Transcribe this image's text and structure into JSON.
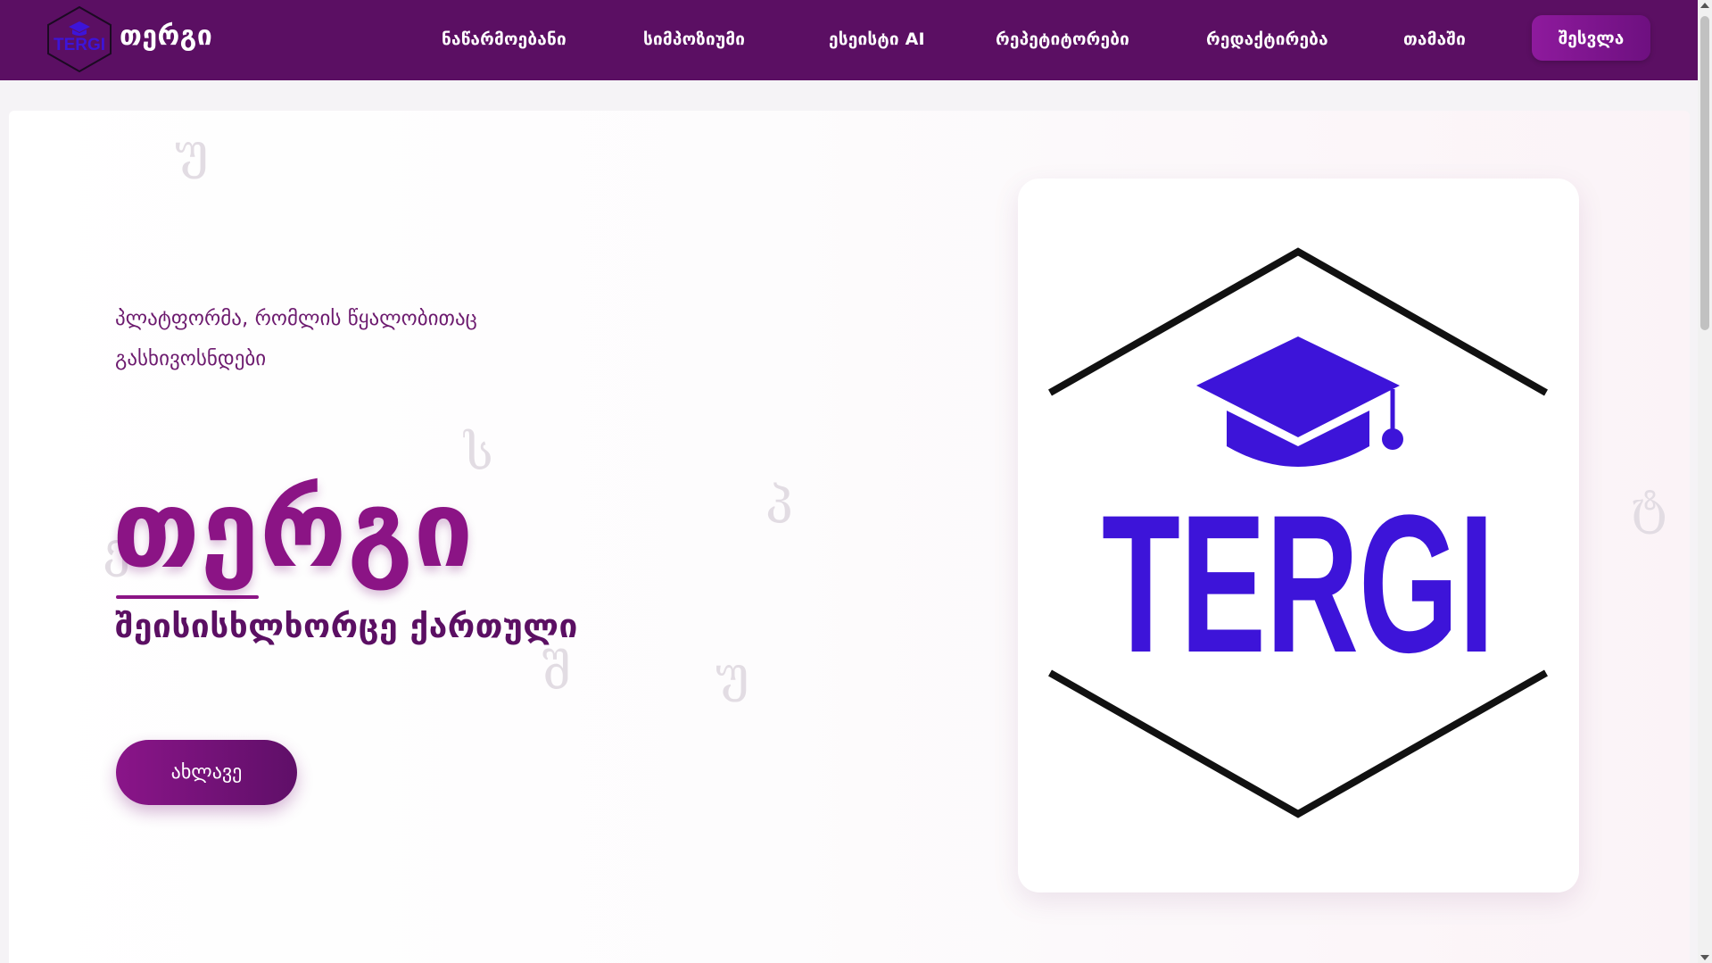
{
  "brand": {
    "name": "თერგი",
    "logo_text": "TERGI"
  },
  "nav": {
    "items": [
      "ნაწარმოებანი",
      "სიმპოზიუმი",
      "ესეისტი AI",
      "რეპეტიტორები",
      "რედაქტირება",
      "თამაში"
    ],
    "login_label": "შესვლა"
  },
  "hero": {
    "tagline": "პლატფორმა, რომლის წყალობითაც გასხივოსნდები",
    "title": "თერგი",
    "subtitle": "შეისისხლხორცე ქართული",
    "cta_label": "ახლავე",
    "logo_text": "TERGI",
    "bg_letters": [
      "უ",
      "ს",
      "პ",
      "შ",
      "უ",
      "ტ",
      "ე"
    ]
  },
  "colors": {
    "navbar": "#5b0f63",
    "accent": "#8b1485",
    "logo_blue": "#3d14d9"
  }
}
